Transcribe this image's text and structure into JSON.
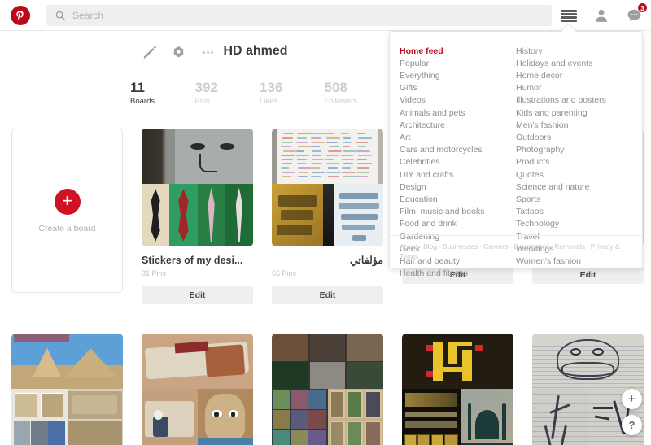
{
  "header": {
    "logo_icon": "pinterest-logo-icon",
    "search": {
      "placeholder": "Search",
      "value": "",
      "icon": "search-icon"
    },
    "menu_icon": "hamburger-menu-icon",
    "profile_icon": "person-icon",
    "messages_icon": "message-bubble-icon",
    "messages_badge": "3",
    "badge_color": "#bd081c"
  },
  "dropdown": {
    "left_column": [
      "Home feed",
      "Popular",
      "Everything",
      "Gifts",
      "Videos",
      "Animals and pets",
      "Architecture",
      "Art",
      "Cars and motorcycles",
      "Celebrities",
      "DIY and crafts",
      "Design",
      "Education",
      "Film, music and books",
      "Food and drink",
      "Gardening",
      "Geek",
      "Hair and beauty",
      "Health and fitness"
    ],
    "active_item": "Home feed",
    "right_column": [
      "History",
      "Holidays and events",
      "Home decor",
      "Humor",
      "Illustrations and posters",
      "Kids and parenting",
      "Men's fashion",
      "Outdoors",
      "Photography",
      "Products",
      "Quotes",
      "Science and nature",
      "Sports",
      "Tattoos",
      "Technology",
      "Travel",
      "Weddings",
      "Women's fashion"
    ],
    "footer_links": [
      "About",
      "Blog",
      "Businesses",
      "Careers",
      "Developers",
      "Removals",
      "Privacy & Terms"
    ]
  },
  "profile": {
    "name": "HD ahmed",
    "actions": [
      {
        "name": "edit-profile-icon",
        "label": "pencil-icon"
      },
      {
        "name": "settings-icon",
        "label": "gear-icon"
      },
      {
        "name": "more-options-icon",
        "label": "ellipsis-icon"
      }
    ],
    "stats": [
      {
        "num": "11",
        "label": "Boards",
        "active": true
      },
      {
        "num": "392",
        "label": "Pins",
        "active": false
      },
      {
        "num": "136",
        "label": "Likes",
        "active": false
      },
      {
        "num": "508",
        "label": "Followers",
        "active": false
      }
    ]
  },
  "create_board": {
    "label": "Create a board",
    "icon": "plus-icon",
    "accent": "#cf1322"
  },
  "boards": {
    "edit_label": "Edit",
    "row1": [
      {
        "title": "Stickers of my desi...",
        "pins": "31 Pins",
        "rtl": false,
        "edit": "Edit"
      },
      {
        "title": "مؤلفاتي",
        "pins": "65 Pins",
        "rtl": true,
        "edit": "Edit"
      },
      {
        "title": "",
        "pins": "",
        "rtl": false,
        "edit": "Edit"
      },
      {
        "title": "",
        "pins": "",
        "rtl": false,
        "edit": "Edit"
      }
    ],
    "row2": [
      {
        "title": "",
        "pins": "",
        "rtl": false,
        "edit": ""
      },
      {
        "title": "",
        "pins": "",
        "rtl": false,
        "edit": ""
      },
      {
        "title": "",
        "pins": "",
        "rtl": false,
        "edit": ""
      },
      {
        "title": "",
        "pins": "",
        "rtl": false,
        "edit": ""
      },
      {
        "title": "",
        "pins": "",
        "rtl": false,
        "edit": ""
      }
    ]
  },
  "floating": {
    "add_label": "+",
    "help_label": "?"
  }
}
